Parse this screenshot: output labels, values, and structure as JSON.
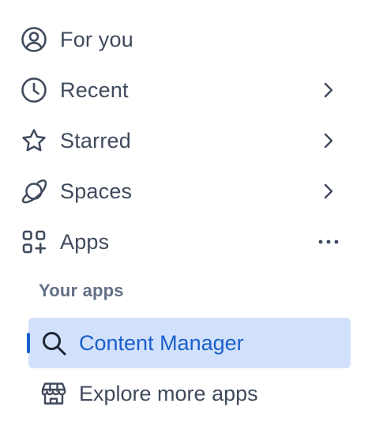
{
  "nav": {
    "items": [
      {
        "label": "For you",
        "icon": "user-circle-icon"
      },
      {
        "label": "Recent",
        "icon": "clock-icon",
        "trailing": "chevron-right-icon"
      },
      {
        "label": "Starred",
        "icon": "star-icon",
        "trailing": "chevron-right-icon"
      },
      {
        "label": "Spaces",
        "icon": "planet-icon",
        "trailing": "chevron-right-icon"
      },
      {
        "label": "Apps",
        "icon": "apps-grid-icon",
        "trailing": "more-options-icon"
      }
    ]
  },
  "your_apps": {
    "heading": "Your apps",
    "items": [
      {
        "label": "Content Manager",
        "icon": "search-icon",
        "selected": true
      },
      {
        "label": "Explore more apps",
        "icon": "marketplace-store-icon",
        "selected": false
      }
    ]
  },
  "colors": {
    "text": "#3f4a5c",
    "heading": "#626f86",
    "selected_bg": "#d2e1fb",
    "selected_text": "#1a5fcb"
  }
}
